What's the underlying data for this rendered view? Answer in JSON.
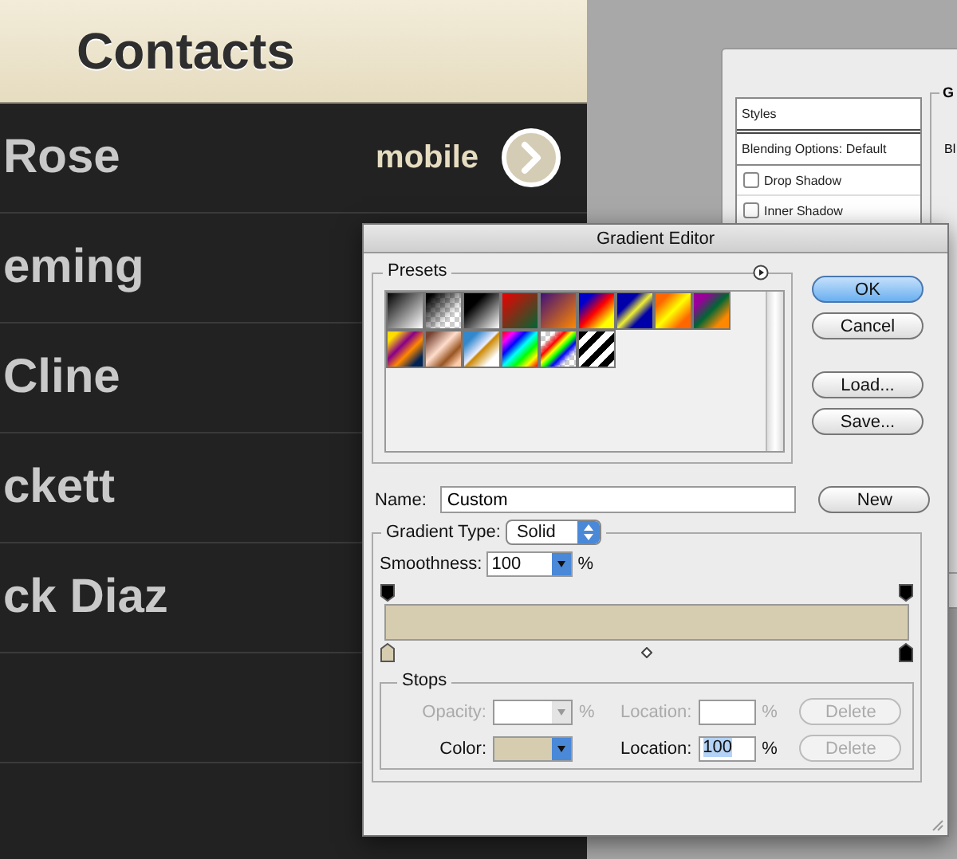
{
  "contacts": {
    "title": "Contacts",
    "rows": [
      {
        "name": "Rose",
        "label": "mobile"
      },
      {
        "name": "eming"
      },
      {
        "name": "Cline"
      },
      {
        "name": "ckett"
      },
      {
        "name": "ck Diaz"
      }
    ]
  },
  "layer_style": {
    "list_header": "Styles",
    "items": [
      {
        "kind": "header",
        "label": "Blending Options: Default"
      },
      {
        "kind": "checkbox",
        "label": "Drop Shadow",
        "checked": false
      },
      {
        "kind": "checkbox",
        "label": "Inner Shadow",
        "checked": false
      }
    ],
    "group_title": "G",
    "group_text": "Bl"
  },
  "gradient_editor": {
    "title": "Gradient Editor",
    "presets_label": "Presets",
    "buttons": [
      {
        "label": "OK",
        "default": true
      },
      {
        "label": "Cancel",
        "default": false
      },
      {
        "label": "Load...",
        "default": false
      },
      {
        "label": "Save...",
        "default": false
      }
    ],
    "name_label": "Name:",
    "name_value": "Custom",
    "new_button": "New",
    "type_label": "Gradient Type:",
    "type_value": "Solid",
    "smoothness_label": "Smoothness:",
    "smoothness_value": "100",
    "smoothness_unit": "%",
    "stops_label": "Stops",
    "stops": [
      {
        "kind": "opacity",
        "label": "Opacity:",
        "unit": "%",
        "location_label": "Location:",
        "location_unit": "%",
        "delete": "Delete",
        "disabled": true,
        "delete_disabled": true
      },
      {
        "kind": "color",
        "label": "Color:",
        "color": "#d6ccb0",
        "location_label": "Location:",
        "location": "100",
        "location_unit": "%",
        "delete": "Delete",
        "disabled": false,
        "delete_disabled": true
      }
    ]
  }
}
